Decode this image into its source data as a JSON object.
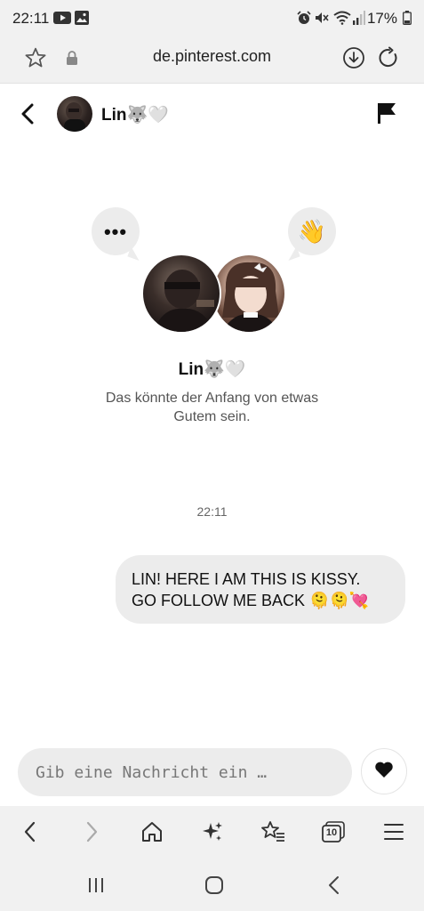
{
  "status_bar": {
    "time": "22:11",
    "battery": "17%",
    "icons": [
      "youtube-icon",
      "gallery-icon",
      "alarm-icon",
      "mute-icon",
      "wifi-icon",
      "signal-icon",
      "battery-icon"
    ]
  },
  "address_bar": {
    "url": "de.pinterest.com",
    "icons": [
      "star-icon",
      "lock-icon",
      "download-icon",
      "reload-icon"
    ]
  },
  "chat_header": {
    "name": "Lin🐺🤍"
  },
  "intro": {
    "dots": "•••",
    "wave": "👋",
    "name": "Lin🐺🤍",
    "subtitle": "Das könnte der Anfang von etwas Gutem sein."
  },
  "conversation": {
    "timestamp": "22:11",
    "messages": [
      {
        "text": "LIN! HERE I AM THIS IS KISSY. GO FOLLOW ME BACK 🫠🫠💘",
        "sender": "me"
      }
    ]
  },
  "composer": {
    "placeholder": "Gib eine Nachricht ein …"
  },
  "browser_toolbar": {
    "tabs_count": "10"
  },
  "colors": {
    "chrome_bg": "#f1f1f1",
    "bubble_bg": "#ececec",
    "text": "#111111",
    "muted": "#555555"
  }
}
